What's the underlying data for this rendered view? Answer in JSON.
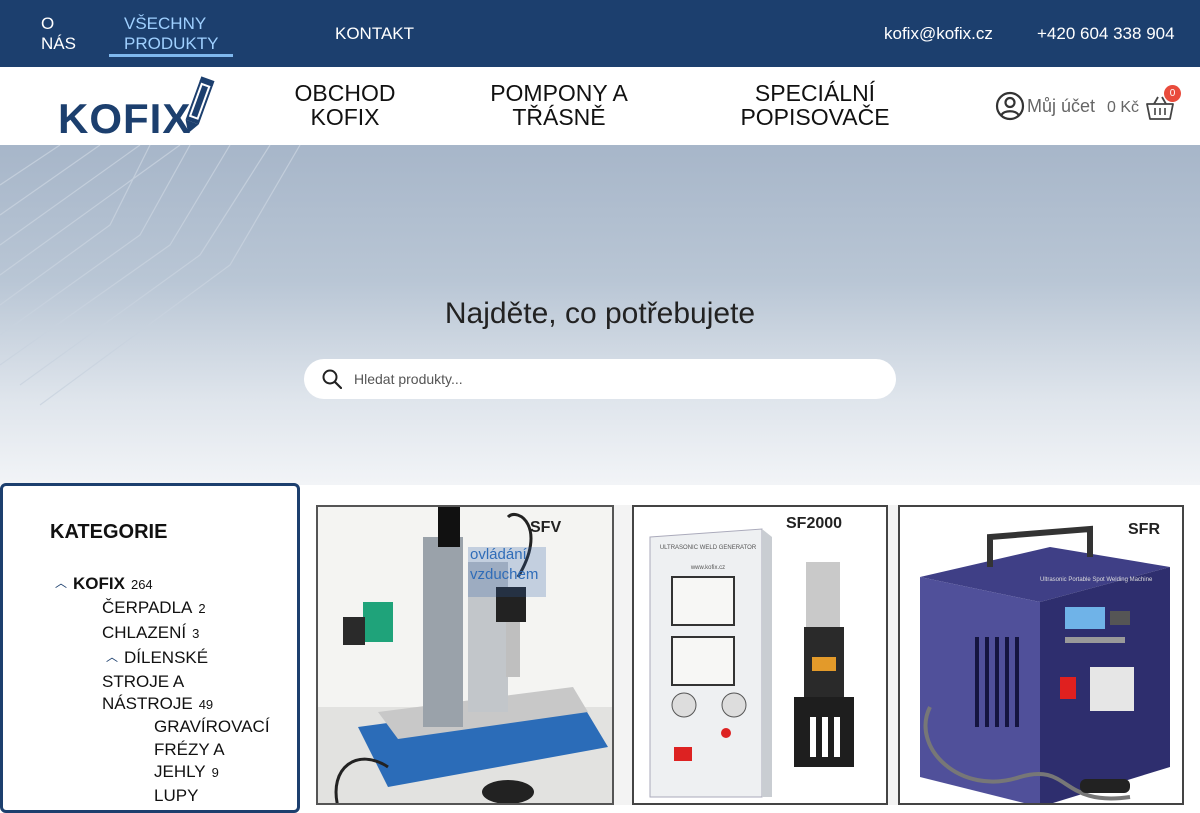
{
  "topbar": {
    "nav": [
      {
        "label": "O NÁS"
      },
      {
        "label": "VŠECHNY PRODUKTY"
      },
      {
        "label": "KONTAKT"
      }
    ],
    "email": "kofix@kofix.cz",
    "phone": "+420 604 338 904"
  },
  "header": {
    "logo_text": "KOFIX",
    "mainnav": [
      {
        "label": "OBCHOD KOFIX"
      },
      {
        "label": "POMPONY A TŘÁSNĚ"
      },
      {
        "label": "SPECIÁLNÍ POPISOVAČE"
      }
    ],
    "account_label": "Můj účet",
    "cart_total": "0 Kč",
    "cart_count": "0"
  },
  "hero": {
    "title": "Najděte, co potřebujete",
    "search_placeholder": "Hledat produkty..."
  },
  "sidebar": {
    "title": "KATEGORIE",
    "items": [
      {
        "label": "KOFIX",
        "count": "264"
      },
      {
        "label": "ČERPADLA",
        "count": "2"
      },
      {
        "label": "CHLAZENÍ",
        "count": "3"
      },
      {
        "label_line1": "DÍLENSKÉ",
        "label_line2": "STROJE A",
        "label_line3": "NÁSTROJE",
        "count": "49"
      },
      {
        "label_line1": "GRAVÍROVACÍ",
        "label_line2": "FRÉZY A",
        "label_line3": "JEHLY",
        "count": "9"
      },
      {
        "label": "LUPY"
      }
    ]
  },
  "products": [
    {
      "label": "SFV",
      "overlay_line1": "ovládání",
      "overlay_line2": "vzduchem"
    },
    {
      "label": "SF2000",
      "device_text": "ULTRASONIC WELD GENERATOR",
      "url_text": "www.kofix.cz"
    },
    {
      "label": "SFR",
      "device_text": "Ultrasonic Portable Spot Welding Machine"
    }
  ],
  "colors": {
    "brand": "#1c3f6e",
    "active_nav": "#9fd0ff",
    "cart_badge": "#e94b3c"
  }
}
